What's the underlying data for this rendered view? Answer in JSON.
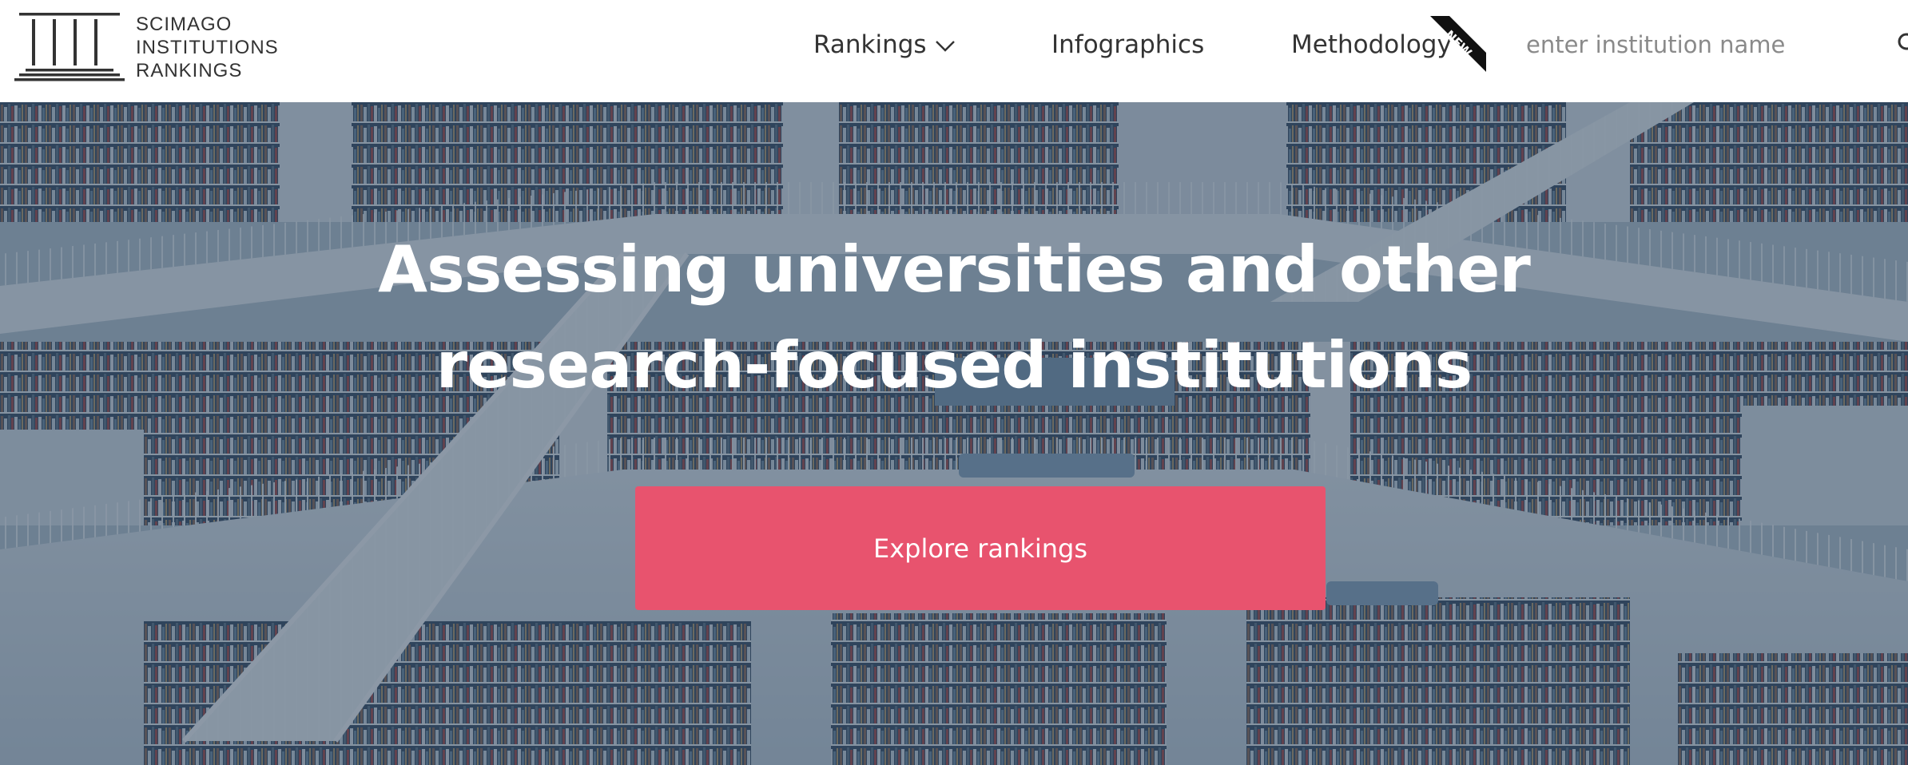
{
  "brand": {
    "name_lines": [
      "SCIMAGO",
      "INSTITUTIONS",
      "RANKINGS"
    ]
  },
  "nav": {
    "rankings_label": "Rankings",
    "infographics_label": "Infographics",
    "methodology_label": "Methodology",
    "new_badge": "NEW"
  },
  "search": {
    "placeholder": "enter institution name",
    "value": ""
  },
  "hero": {
    "title_line1": "Assessing universities and other",
    "title_line2": "research-focused institutions",
    "cta_label": "Explore rankings"
  },
  "colors": {
    "cta": "#e8536e",
    "overlay": "#233a52",
    "text_dark": "#333333",
    "ribbon": "#111111"
  },
  "icons": {
    "rankings_dropdown": "chevron-down-icon",
    "search": "search-icon",
    "logo": "columns-logo-icon"
  }
}
